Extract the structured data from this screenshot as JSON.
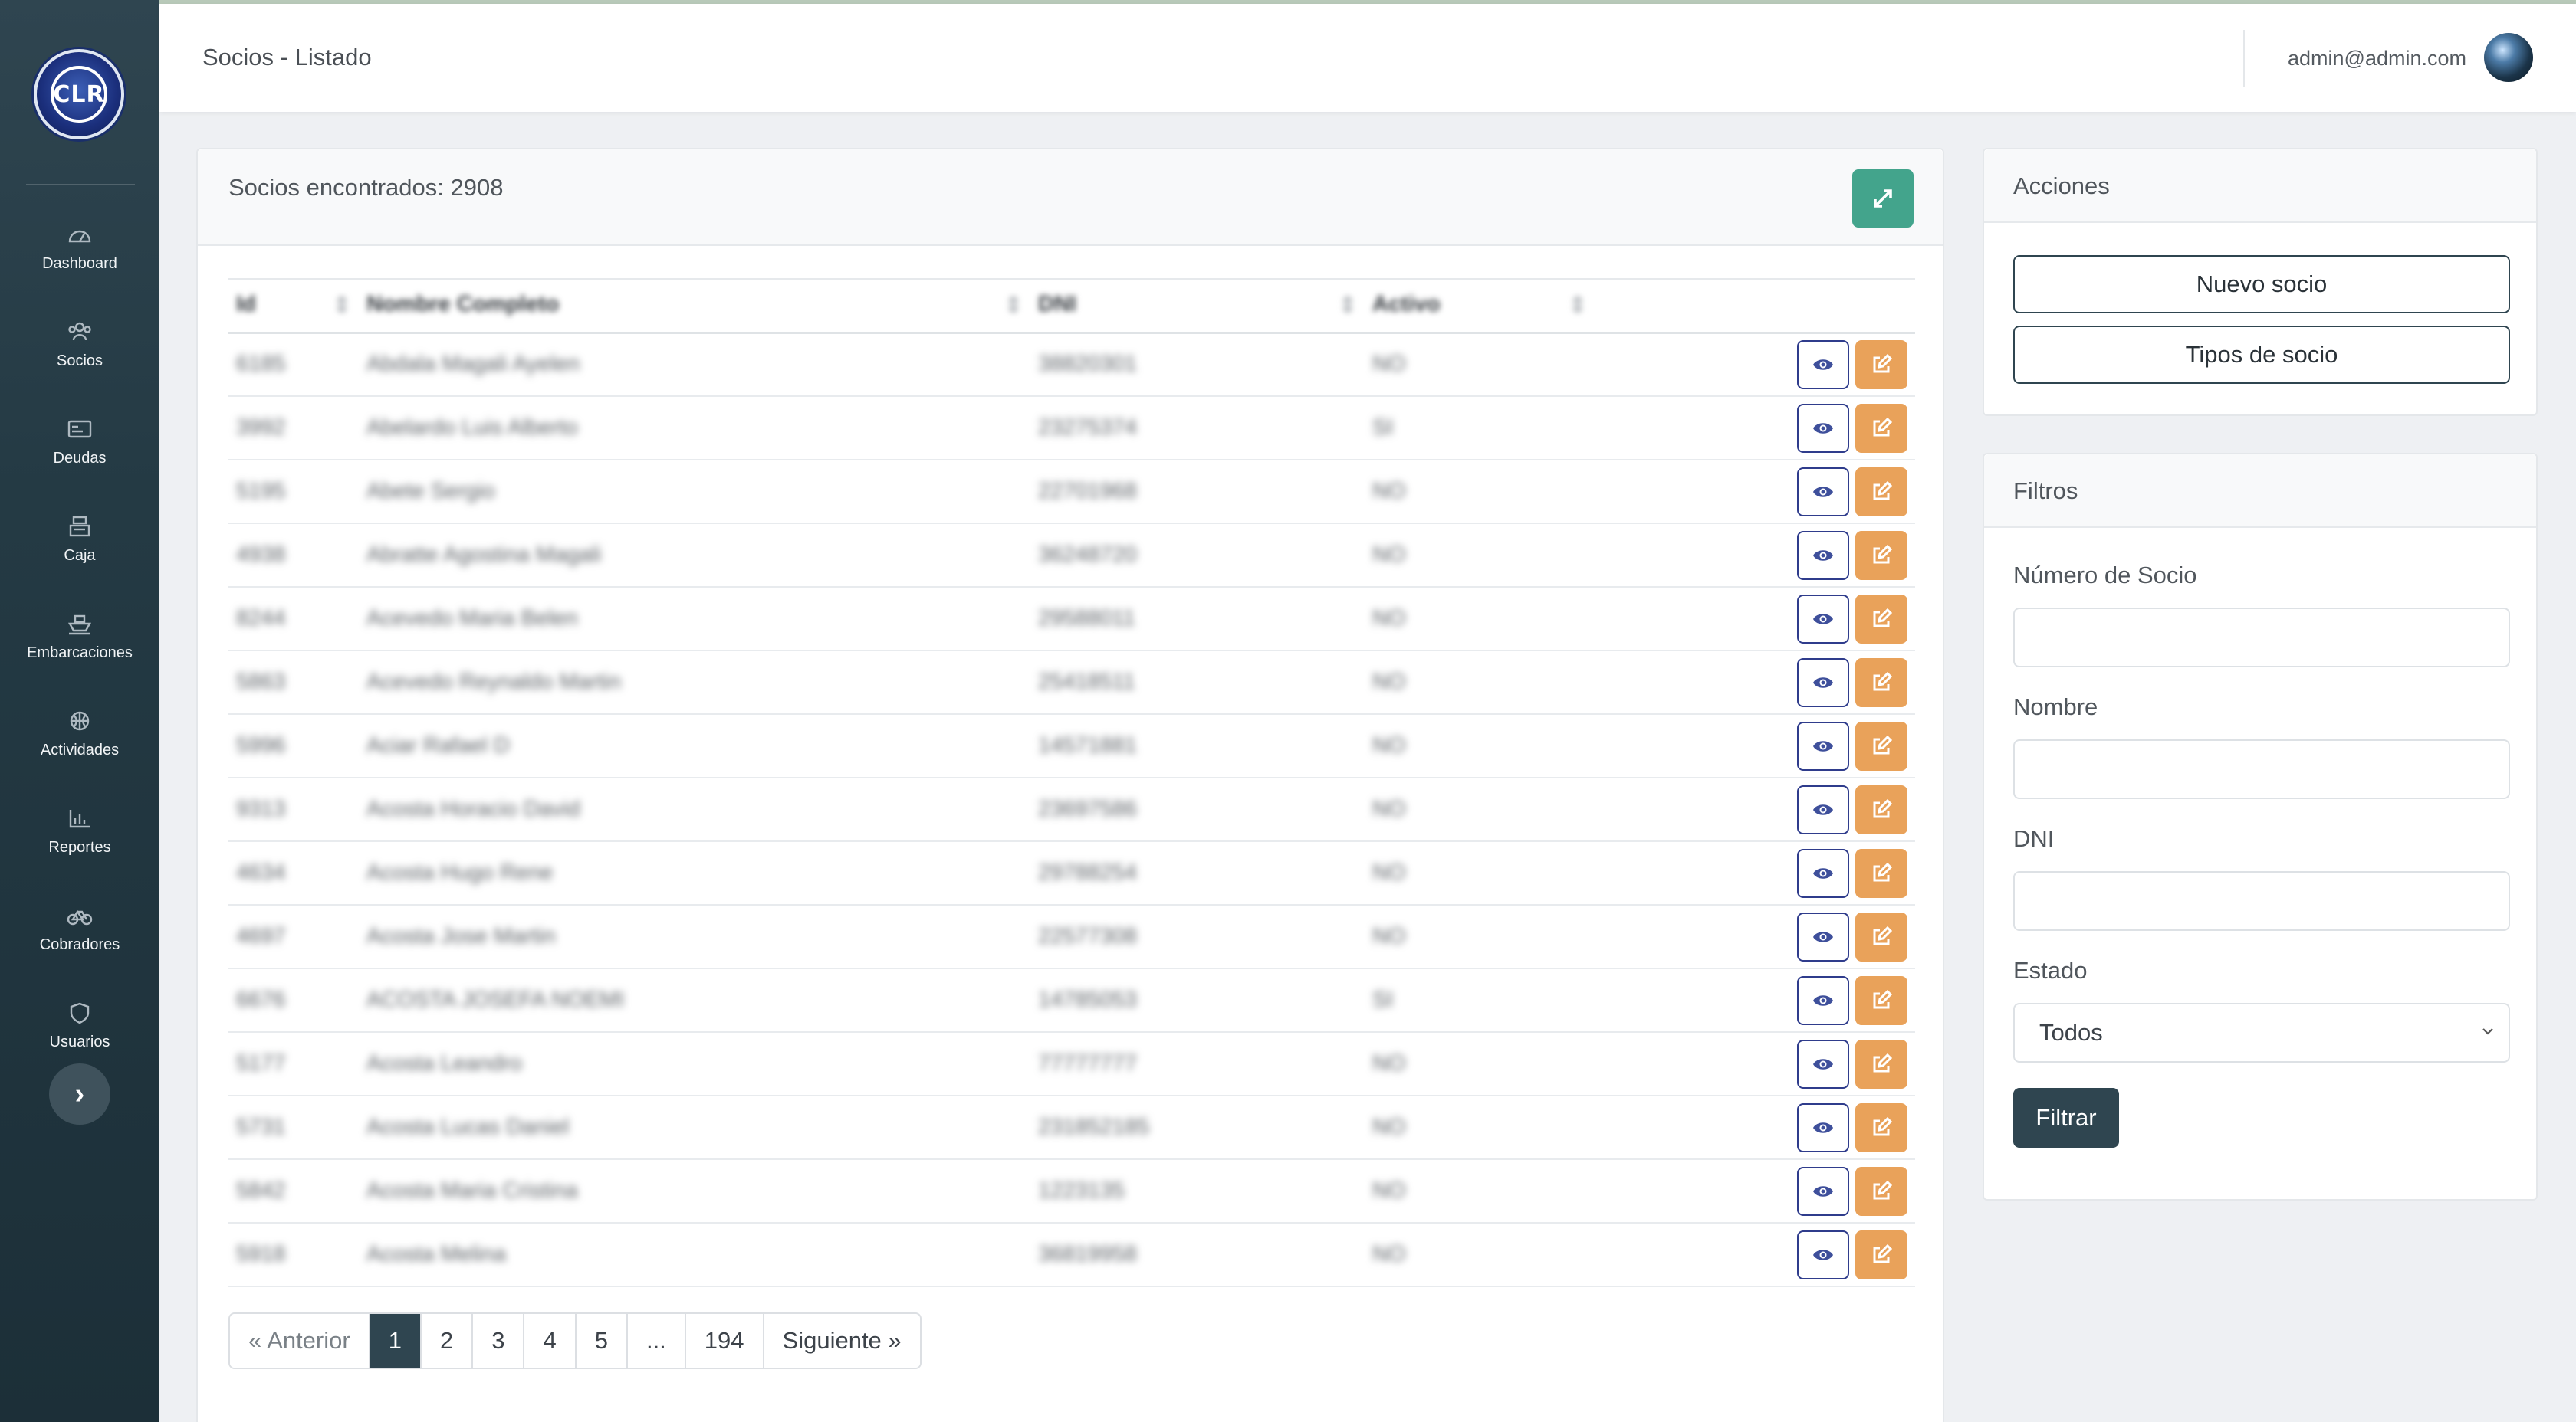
{
  "app": {
    "logo_text": "CLR"
  },
  "sidebar": {
    "items": [
      {
        "label": "Dashboard",
        "icon": "dashboard-icon"
      },
      {
        "label": "Socios",
        "icon": "users-icon"
      },
      {
        "label": "Deudas",
        "icon": "debt-card-icon"
      },
      {
        "label": "Caja",
        "icon": "cash-register-icon"
      },
      {
        "label": "Embarcaciones",
        "icon": "ship-icon"
      },
      {
        "label": "Actividades",
        "icon": "basketball-icon"
      },
      {
        "label": "Reportes",
        "icon": "bar-chart-icon"
      },
      {
        "label": "Cobradores",
        "icon": "bicycle-icon"
      },
      {
        "label": "Usuarios",
        "icon": "shield-icon"
      }
    ],
    "toggle_glyph": "›"
  },
  "header": {
    "title": "Socios - Listado",
    "user_email": "admin@admin.com"
  },
  "main": {
    "found_text": "Socios encontrados: 2908",
    "columns": [
      {
        "label": "Id",
        "sort": "⇕"
      },
      {
        "label": "Nombre Completo",
        "sort": "⇕"
      },
      {
        "label": "DNI",
        "sort": "⇕"
      },
      {
        "label": "Activo",
        "sort": "⇕"
      }
    ],
    "rows": [
      {
        "id": "6185",
        "name": "Abdala Magali Ayelen",
        "dni": "38820301",
        "active": "NO"
      },
      {
        "id": "3992",
        "name": "Abelardo Luis Alberto",
        "dni": "23275374",
        "active": "SI"
      },
      {
        "id": "5195",
        "name": "Abete Sergio",
        "dni": "22701968",
        "active": "NO"
      },
      {
        "id": "4938",
        "name": "Abratte Agostina Magali",
        "dni": "36248720",
        "active": "NO"
      },
      {
        "id": "8244",
        "name": "Acevedo Maria Belen",
        "dni": "29588011",
        "active": "NO"
      },
      {
        "id": "5863",
        "name": "Acevedo Reynaldo Martin",
        "dni": "25418511",
        "active": "NO"
      },
      {
        "id": "5996",
        "name": "Aciar Rafael D",
        "dni": "14571881",
        "active": "NO"
      },
      {
        "id": "9313",
        "name": "Acosta Horacio David",
        "dni": "23697586",
        "active": "NO"
      },
      {
        "id": "4634",
        "name": "Acosta Hugo Rene",
        "dni": "29788254",
        "active": "NO"
      },
      {
        "id": "4697",
        "name": "Acosta Jose Martin",
        "dni": "22577308",
        "active": "NO"
      },
      {
        "id": "6676",
        "name": "ACOSTA JOSEFA NOEMI",
        "dni": "14785053",
        "active": "SI"
      },
      {
        "id": "5177",
        "name": "Acosta Leandro",
        "dni": "77777777",
        "active": "NO"
      },
      {
        "id": "5731",
        "name": "Acosta Lucas Daniel",
        "dni": "231852185",
        "active": "NO"
      },
      {
        "id": "5842",
        "name": "Acosta Maria Cristina",
        "dni": "1223135",
        "active": "NO"
      },
      {
        "id": "5918",
        "name": "Acosta Melina",
        "dni": "36819958",
        "active": "NO"
      }
    ],
    "row_actions": {
      "view_icon": "eye-icon",
      "edit_icon": "edit-icon"
    },
    "pagination": [
      "« Anterior",
      "1",
      "2",
      "3",
      "4",
      "5",
      "...",
      "194",
      "Siguiente »"
    ],
    "pagination_active": "1"
  },
  "acciones": {
    "title": "Acciones",
    "new_member": "Nuevo socio",
    "member_types": "Tipos de socio"
  },
  "filtros": {
    "title": "Filtros",
    "numero_label": "Número de Socio",
    "nombre_label": "Nombre",
    "dni_label": "DNI",
    "estado_label": "Estado",
    "estado_value": "Todos",
    "submit": "Filtrar"
  },
  "colors": {
    "accent": "#2f4550",
    "expand": "#43a48c",
    "edit": "#e9a25a",
    "view_border": "#2f3c8c"
  }
}
